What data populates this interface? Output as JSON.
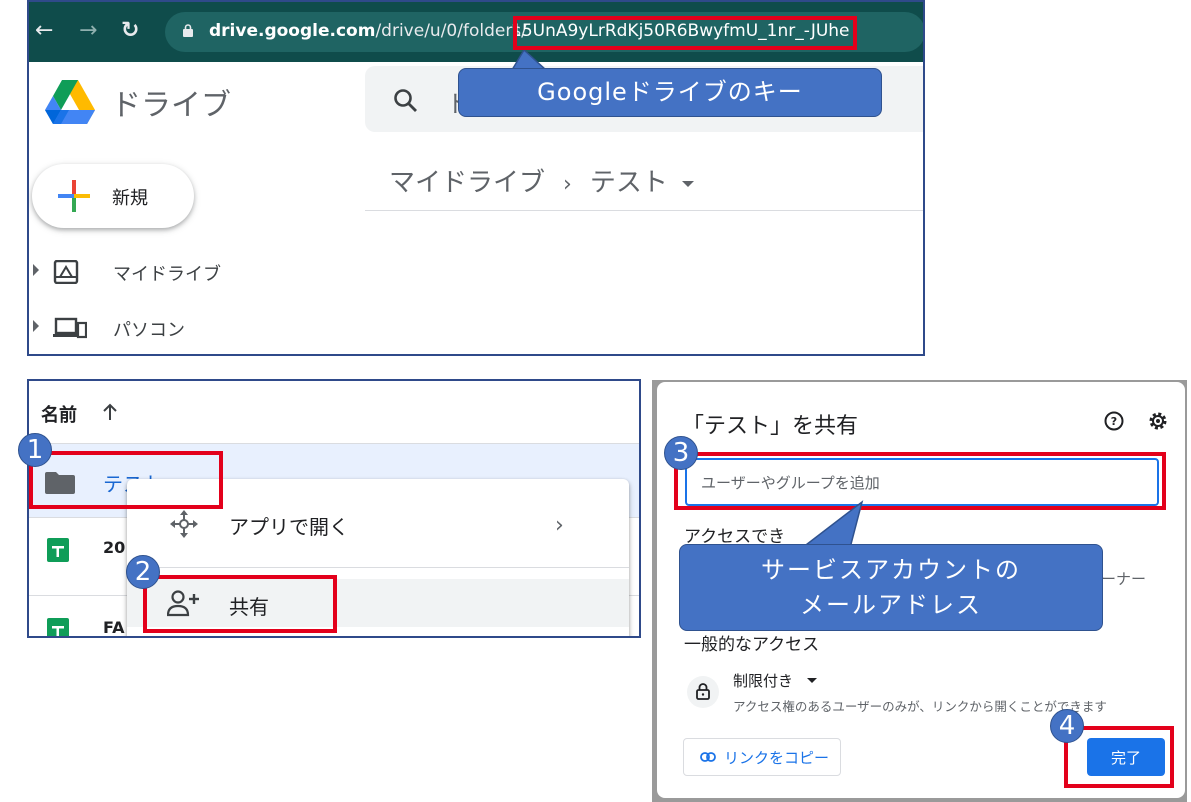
{
  "browser": {
    "url_prefix_bold": "drive.google.com",
    "url_prefix_rest": "/drive/u/0/folders/",
    "url_key": "15UnA9yLrRdKj50R6BwyfmU_1nr_-JUhe"
  },
  "drive": {
    "app_name": "ドライブ",
    "search_placeholder": "ド",
    "new_button": "新規",
    "sidebar": [
      {
        "label": "マイドライブ",
        "icon": "my-drive-icon"
      },
      {
        "label": "パソコン",
        "icon": "computer-icon"
      }
    ],
    "breadcrumb": {
      "root": "マイドライブ",
      "separator": "›",
      "current": "テスト"
    }
  },
  "callouts": {
    "drive_key": "Googleドライブのキー",
    "service_account_line1": "サービスアカウントの",
    "service_account_line2": "メールアドレス"
  },
  "file_list": {
    "column_name": "名前",
    "rows": [
      {
        "name": "テスト",
        "type": "folder",
        "selected": true
      },
      {
        "name": "20",
        "type": "sheet"
      },
      {
        "name": "FA",
        "type": "sheet"
      }
    ]
  },
  "context_menu": {
    "open_with": "アプリで開く",
    "chevron": "›",
    "share": "共有"
  },
  "share_dialog": {
    "title": "「テスト」を共有",
    "add_placeholder": "ユーザーやグループを追加",
    "access_heading": "アクセスでき",
    "owner_text": "ーナー",
    "general_heading": "一般的なアクセス",
    "restriction": "制限付き",
    "restriction_desc": "アクセス権のあるユーザーのみが、リンクから開くことができます",
    "copy_link": "リンクをコピー",
    "done": "完了"
  },
  "steps": [
    "1",
    "2",
    "3",
    "4"
  ],
  "colors": {
    "highlight_red": "#e3001b",
    "callout_blue": "#4472c4",
    "google_blue": "#1a73e8",
    "browser_bar": "#0f4c4b"
  }
}
